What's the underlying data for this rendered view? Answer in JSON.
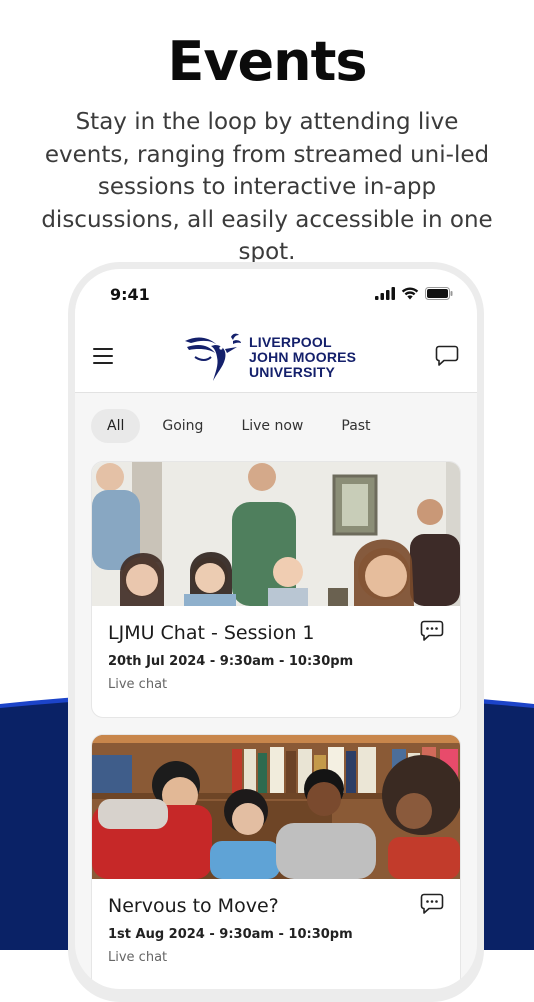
{
  "promo": {
    "title": "Events",
    "subtitle": "Stay in the loop by attending live events, ranging from streamed uni-led sessions to interactive in-app discussions, all easily accessible in one spot."
  },
  "colors": {
    "navy": "#0a2266",
    "accent_blue": "#1c44c9",
    "logo_text": "#14206b"
  },
  "status_bar": {
    "time": "9:41",
    "icons": [
      "signal-icon",
      "wifi-icon",
      "battery-icon"
    ]
  },
  "app_bar": {
    "menu_icon": "hamburger-menu-icon",
    "logo_lines": [
      "LIVERPOOL",
      "JOHN MOORES",
      "UNIVERSITY"
    ],
    "chat_icon": "chat-bubble-icon"
  },
  "tabs": [
    {
      "label": "All",
      "active": true
    },
    {
      "label": "Going",
      "active": false
    },
    {
      "label": "Live now",
      "active": false
    },
    {
      "label": "Past",
      "active": false
    }
  ],
  "events": [
    {
      "title": "LJMU Chat - Session 1",
      "datetime": "20th Jul 2024 - 9:30am - 10:30pm",
      "type": "Live chat",
      "image": "students-group-photo"
    },
    {
      "title": "Nervous to Move?",
      "datetime": "1st Aug 2024 - 9:30am - 10:30pm",
      "type": "Live chat",
      "image": "students-library-photo"
    }
  ]
}
